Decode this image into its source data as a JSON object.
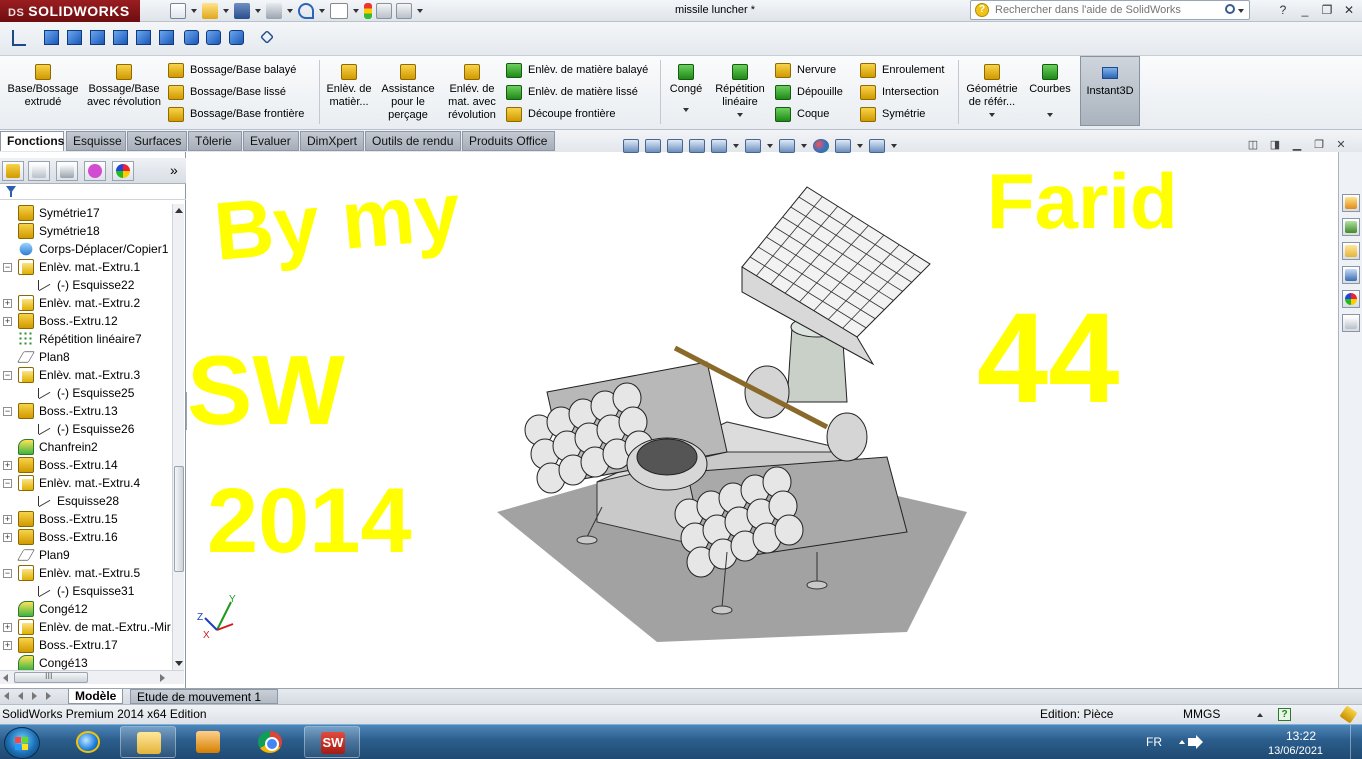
{
  "app": {
    "logo_text": "SOLIDWORKS",
    "logo_prefix": "DS",
    "document_title": "missile luncher *",
    "search_placeholder": "Rechercher dans l'aide de SolidWorks",
    "search_icon": "question-icon",
    "window_controls": [
      "?",
      "_",
      "❐",
      "✕"
    ]
  },
  "command_manager": {
    "big_buttons": [
      {
        "id": "extrude",
        "label": "Base/Bossage extrudé"
      },
      {
        "id": "revolve",
        "label": "Bossage/Base avec révolution"
      },
      {
        "id": "cut-extrude",
        "label": "Enlèv. de matièr..."
      },
      {
        "id": "hole-wizard",
        "label": "Assistance pour le perçage"
      },
      {
        "id": "cut-revolve",
        "label": "Enlév. de mat. avec révolution"
      },
      {
        "id": "fillet",
        "label": "Congé"
      },
      {
        "id": "linear-pattern",
        "label": "Répétition linéaire"
      },
      {
        "id": "ref-geometry",
        "label": "Géométrie de référ..."
      },
      {
        "id": "curves",
        "label": "Courbes"
      },
      {
        "id": "instant3d",
        "label": "Instant3D"
      }
    ],
    "small_buttons": {
      "swept_boss": "Bossage/Base balayé",
      "lofted_boss": "Bossage/Base lissé",
      "boundary_boss": "Bossage/Base frontière",
      "swept_cut": "Enlèv. de matière balayé",
      "lofted_cut": "Enlèv. de matière lissé",
      "boundary_cut": "Découpe frontière",
      "rib": "Nervure",
      "draft": "Dépouille",
      "shell": "Coque",
      "wrap": "Enroulement",
      "intersect": "Intersection",
      "mirror": "Symétrie"
    }
  },
  "tabs": [
    {
      "label": "Fonctions",
      "active": true
    },
    {
      "label": "Esquisse",
      "active": false
    },
    {
      "label": "Surfaces",
      "active": false
    },
    {
      "label": "Tôlerie",
      "active": false
    },
    {
      "label": "Evaluer",
      "active": false
    },
    {
      "label": "DimXpert",
      "active": false
    },
    {
      "label": "Outils de rendu",
      "active": false
    },
    {
      "label": "Produits Office",
      "active": false
    }
  ],
  "panel": {
    "tabs_more": "»",
    "tree": [
      {
        "label": "Symétrie17",
        "icon": "mirror-icon",
        "expander": "",
        "indent": 1
      },
      {
        "label": "Symétrie18",
        "icon": "mirror-icon",
        "expander": "",
        "indent": 1
      },
      {
        "label": "Corps-Déplacer/Copier1",
        "icon": "move-body-icon",
        "expander": "",
        "indent": 1
      },
      {
        "label": "Enlèv. mat.-Extru.1",
        "icon": "cut-extrude-icon",
        "expander": "−",
        "indent": 1
      },
      {
        "label": "(-) Esquisse22",
        "icon": "sketch-icon",
        "expander": "",
        "indent": 2
      },
      {
        "label": "Enlèv. mat.-Extru.2",
        "icon": "cut-extrude-icon",
        "expander": "+",
        "indent": 1
      },
      {
        "label": "Boss.-Extru.12",
        "icon": "boss-extrude-icon",
        "expander": "+",
        "indent": 1
      },
      {
        "label": "Répétition linéaire7",
        "icon": "linear-pattern-icon",
        "expander": "",
        "indent": 1
      },
      {
        "label": "Plan8",
        "icon": "plane-icon",
        "expander": "",
        "indent": 1
      },
      {
        "label": "Enlèv. mat.-Extru.3",
        "icon": "cut-extrude-icon",
        "expander": "−",
        "indent": 1
      },
      {
        "label": "(-) Esquisse25",
        "icon": "sketch-icon",
        "expander": "",
        "indent": 2
      },
      {
        "label": "Boss.-Extru.13",
        "icon": "boss-extrude-icon",
        "expander": "−",
        "indent": 1
      },
      {
        "label": "(-) Esquisse26",
        "icon": "sketch-icon",
        "expander": "",
        "indent": 2
      },
      {
        "label": "Chanfrein2",
        "icon": "chamfer-icon",
        "expander": "",
        "indent": 1
      },
      {
        "label": "Boss.-Extru.14",
        "icon": "boss-extrude-icon",
        "expander": "+",
        "indent": 1
      },
      {
        "label": "Enlèv. mat.-Extru.4",
        "icon": "cut-extrude-icon",
        "expander": "−",
        "indent": 1
      },
      {
        "label": "Esquisse28",
        "icon": "sketch-icon",
        "expander": "",
        "indent": 2
      },
      {
        "label": "Boss.-Extru.15",
        "icon": "boss-extrude-icon",
        "expander": "+",
        "indent": 1
      },
      {
        "label": "Boss.-Extru.16",
        "icon": "boss-extrude-icon",
        "expander": "+",
        "indent": 1
      },
      {
        "label": "Plan9",
        "icon": "plane-icon",
        "expander": "",
        "indent": 1
      },
      {
        "label": "Enlèv. mat.-Extru.5",
        "icon": "cut-extrude-icon",
        "expander": "−",
        "indent": 1
      },
      {
        "label": "(-) Esquisse31",
        "icon": "sketch-icon",
        "expander": "",
        "indent": 2
      },
      {
        "label": "Congé12",
        "icon": "fillet-icon",
        "expander": "",
        "indent": 1
      },
      {
        "label": "Enlèv. de mat.-Extru.-Mir",
        "icon": "cut-extrude-icon",
        "expander": "+",
        "indent": 1
      },
      {
        "label": "Boss.-Extru.17",
        "icon": "boss-extrude-icon",
        "expander": "+",
        "indent": 1
      },
      {
        "label": "Congé13",
        "icon": "fillet-icon",
        "expander": "",
        "indent": 1
      }
    ],
    "hscroll_grip": "III"
  },
  "viewport": {
    "annotation_color": "#ffff00",
    "annotations": {
      "line1": "By my",
      "line2": "SW",
      "line3": "2014",
      "name": "Farid",
      "num": "44"
    },
    "triad": {
      "x": "X",
      "y": "Y",
      "z": "Z"
    }
  },
  "bottom_tabs": [
    {
      "label": "Modèle",
      "active": true
    },
    {
      "label": "Etude de mouvement 1",
      "active": false
    }
  ],
  "status_bar": {
    "product": "SolidWorks Premium 2014 x64 Edition",
    "mode": "Edition: Pièce",
    "units": "MMGS",
    "help_mark": "?"
  },
  "taskbar": {
    "apps": [
      "start-icon",
      "internet-explorer-icon",
      "file-explorer-icon",
      "media-player-icon",
      "chrome-icon",
      "solidworks-icon"
    ],
    "solidworks_label": "SW",
    "language": "FR",
    "time": "13:22",
    "date": "13/06/2021"
  }
}
